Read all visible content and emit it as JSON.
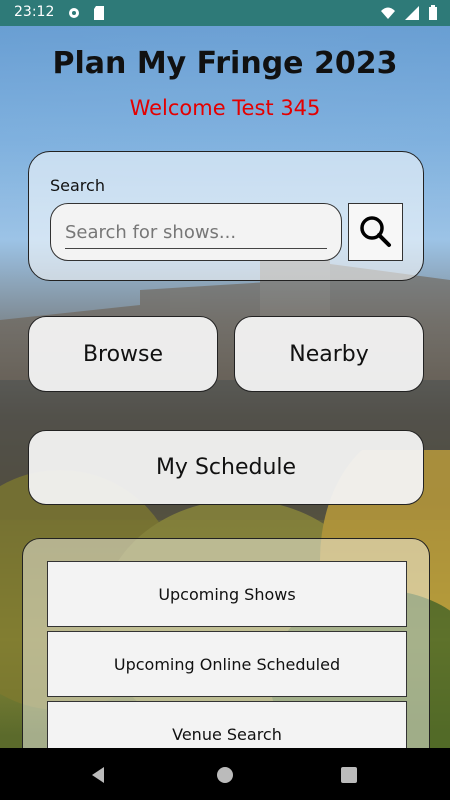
{
  "status_bar": {
    "time": "23:12"
  },
  "header": {
    "title": "Plan My Fringe 2023",
    "welcome": "Welcome Test 345"
  },
  "search": {
    "label": "Search",
    "placeholder": "Search for shows..."
  },
  "buttons": {
    "browse": "Browse",
    "nearby": "Nearby",
    "my_schedule": "My Schedule"
  },
  "menu": {
    "items": [
      "Upcoming Shows",
      "Upcoming Online Scheduled",
      "Venue Search"
    ]
  },
  "colors": {
    "status_bar": "#2e7a78",
    "welcome_text": "#e40000"
  }
}
